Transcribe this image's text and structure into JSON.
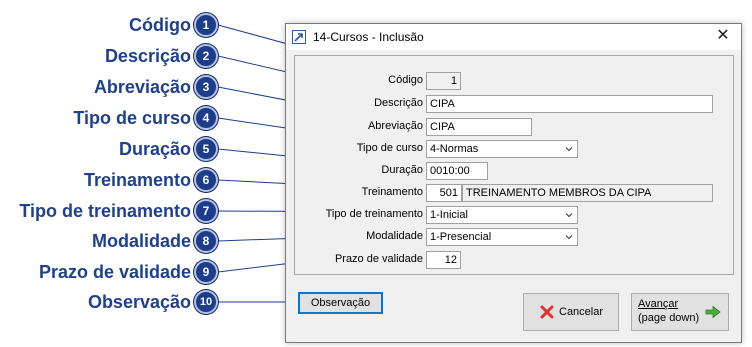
{
  "callouts": [
    {
      "n": "1",
      "label": "Código"
    },
    {
      "n": "2",
      "label": "Descrição"
    },
    {
      "n": "3",
      "label": "Abreviação"
    },
    {
      "n": "4",
      "label": "Tipo de curso"
    },
    {
      "n": "5",
      "label": "Duração"
    },
    {
      "n": "6",
      "label": "Treinamento"
    },
    {
      "n": "7",
      "label": "Tipo de treinamento"
    },
    {
      "n": "8",
      "label": "Modalidade"
    },
    {
      "n": "9",
      "label": "Prazo de validade"
    },
    {
      "n": "10",
      "label": "Observação"
    }
  ],
  "dialog": {
    "title": "14-Cursos - Inclusão",
    "close_glyph": "✕",
    "fields": {
      "codigo": {
        "label": "Código",
        "value": "1"
      },
      "descricao": {
        "label": "Descrição",
        "value": "CIPA"
      },
      "abreviacao": {
        "label": "Abreviação",
        "value": "CIPA"
      },
      "tipo_curso": {
        "label": "Tipo de curso",
        "value": "4-Normas"
      },
      "duracao": {
        "label": "Duração",
        "value": "0010:00"
      },
      "treinamento": {
        "label": "Treinamento",
        "code": "501",
        "name": "TREINAMENTO MEMBROS DA CIPA"
      },
      "tipo_treinamento": {
        "label": "Tipo de treinamento",
        "value": "1-Inicial"
      },
      "modalidade": {
        "label": "Modalidade",
        "value": "1-Presencial"
      },
      "prazo_validade": {
        "label": "Prazo de validade",
        "value": "12"
      }
    },
    "buttons": {
      "observacao": "Observação",
      "cancelar": "Cancelar",
      "avancar_line1": "Avançar",
      "avancar_line2": "(page down)"
    }
  },
  "colors": {
    "callout_text": "#1f3f8f",
    "badge_fill": "#1c3d8c",
    "focus_border": "#0078d7",
    "cancel_icon": "#e03030",
    "next_arrow": "#4caf3a"
  },
  "icons": {
    "window": "app-window-icon",
    "close": "close-icon",
    "cancel": "red-x-icon",
    "next": "green-arrow-right-icon",
    "dropdown": "chevron-down-icon"
  }
}
